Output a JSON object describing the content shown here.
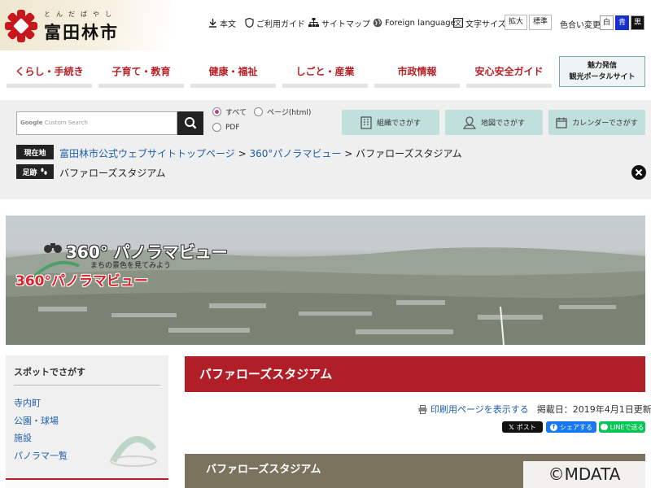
{
  "header": {
    "logo_ruby": "とんだばやし",
    "logo_name": "富田林市",
    "utility": {
      "main_text": "本文",
      "guide": "ご利用ガイド",
      "sitemap": "サイトマップ",
      "foreign": "Foreign language",
      "font_size_label": "文字サイズ",
      "enlarge": "拡大",
      "standard": "標準",
      "color_change_label": "色合い変更",
      "color_white": "白",
      "color_blue": "青",
      "color_black": "黒"
    },
    "colors": {
      "brand_red": "#b61f25",
      "logo_red": "#c8161d"
    }
  },
  "nav": {
    "items": [
      "くらし・手続き",
      "子育て・教育",
      "健康・福祉",
      "しごと・産業",
      "市政情報",
      "安心安全ガイド"
    ],
    "kanko_line1": "魅力発信",
    "kanko_line2": "観光ポータルサイト"
  },
  "search": {
    "placeholder": "Custom Search",
    "google_brand": "Google",
    "scope_all": "すべて",
    "scope_page": "ページ(html)",
    "scope_pdf": "PDF",
    "selected_scope": "すべて",
    "find_by_org": "組織でさがす",
    "find_by_map": "地図でさがす",
    "find_by_calendar": "カレンダーでさがす"
  },
  "breadcrumb": {
    "current_label": "現在地",
    "items": [
      "富田林市公式ウェブサイトトップページ",
      "360°パノラマビュー",
      "バファローズスタジアム"
    ],
    "separator": ">",
    "footprint_label": "足跡",
    "footprint_item": "バファローズスタジアム"
  },
  "hero": {
    "title": "360° パノラマビュー",
    "subtitle": "まちの景色を見てみよう",
    "red_title": "360°パノラマビュー"
  },
  "sidebar": {
    "heading": "スポットでさがす",
    "links": [
      "寺内町",
      "公園・球場",
      "施設",
      "パノラマ一覧"
    ]
  },
  "main": {
    "page_title": "バファローズスタジアム",
    "print_link": "印刷用ページを表示する",
    "published": "掲載日：2019年4月1日更新",
    "sns_x": "ポスト",
    "sns_facebook": "シェアする",
    "sns_line": "LINEで送る",
    "section_title": "バファローズスタジアム"
  },
  "watermark": "©MDATA"
}
